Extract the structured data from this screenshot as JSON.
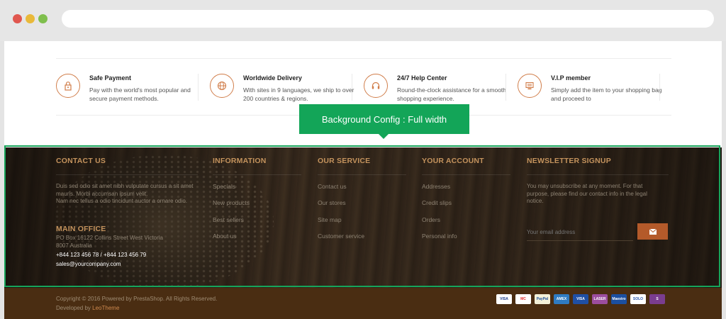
{
  "features": [
    {
      "title": "Safe Payment",
      "desc": "Pay with the world's most popular and secure payment methods.",
      "icon": "lock-icon"
    },
    {
      "title": "Worldwide Delivery",
      "desc": "With sites in 9 languages, we ship to over 200 countries & regions.",
      "icon": "globe-icon"
    },
    {
      "title": "24/7 Help Center",
      "desc": "Round-the-clock assistance for a smooth shopping experience.",
      "icon": "headset-icon"
    },
    {
      "title": "V.I.P member",
      "desc": "Simply add the item to your shopping bag and proceed to",
      "icon": "register-icon"
    }
  ],
  "callout": "Background Config : Full width",
  "contact": {
    "title": "CONTACT US",
    "text1": "Duis sed odio sit amet nibh vulputate cursus a sit amet mauris. Morbi accumsan ipsum velit.",
    "text2": "Nam nec tellus a odio tincidunt auctor a ornare odio.",
    "office_title": "MAIN OFFICE",
    "address1": "PO Box 16122 Collins Street West Victoria",
    "address2": "8007 Australia",
    "phone": "+844 123 456 78 / +844 123 456 79",
    "email": "sales@yourcompany.com"
  },
  "information": {
    "title": "INFORMATION",
    "links": [
      "Specials",
      "New products",
      "Best sellers",
      "About us"
    ]
  },
  "service": {
    "title": "OUR SERVICE",
    "links": [
      "Contact us",
      "Our stores",
      "Site map",
      "Customer service"
    ]
  },
  "account": {
    "title": "YOUR ACCOUNT",
    "links": [
      "Addresses",
      "Credit slips",
      "Orders",
      "Personal info"
    ]
  },
  "newsletter": {
    "title": "NEWSLETTER SIGNUP",
    "text": "You may unsubscribe at any moment. For that purpose, please find our contact info in the legal notice.",
    "placeholder": "Your email address",
    "button_icon": "envelope-icon"
  },
  "copyright": {
    "line1": "Copyright © 2016 Powered by PrestaShop. All Rights Reserved.",
    "line2_prefix": "Developed by ",
    "brand": "LeoTheme"
  },
  "payment_cards": [
    {
      "name": "visa-card-icon",
      "label": "VISA",
      "bg": "#ffffff",
      "fg": "#1a3a8c"
    },
    {
      "name": "mastercard-card-icon",
      "label": "MC",
      "bg": "#ffffff",
      "fg": "#e52a2a"
    },
    {
      "name": "paypal-card-icon",
      "label": "PayPal",
      "bg": "#f3f0d8",
      "fg": "#1b4f9c"
    },
    {
      "name": "amex-card-icon",
      "label": "AMEX",
      "bg": "#2f7bc2",
      "fg": "#ffffff"
    },
    {
      "name": "visa-electron-card-icon",
      "label": "VISA",
      "bg": "#1f4fa4",
      "fg": "#ffffff"
    },
    {
      "name": "laser-card-icon",
      "label": "LASER",
      "bg": "#9b4d9e",
      "fg": "#ffffff"
    },
    {
      "name": "maestro-card-icon",
      "label": "Maestro",
      "bg": "#1b4fa0",
      "fg": "#ffffff"
    },
    {
      "name": "solo-card-icon",
      "label": "SOLO",
      "bg": "#ffffff",
      "fg": "#2a58b0"
    },
    {
      "name": "switch-card-icon",
      "label": "S",
      "bg": "#7a3d8f",
      "fg": "#ffffff"
    }
  ]
}
